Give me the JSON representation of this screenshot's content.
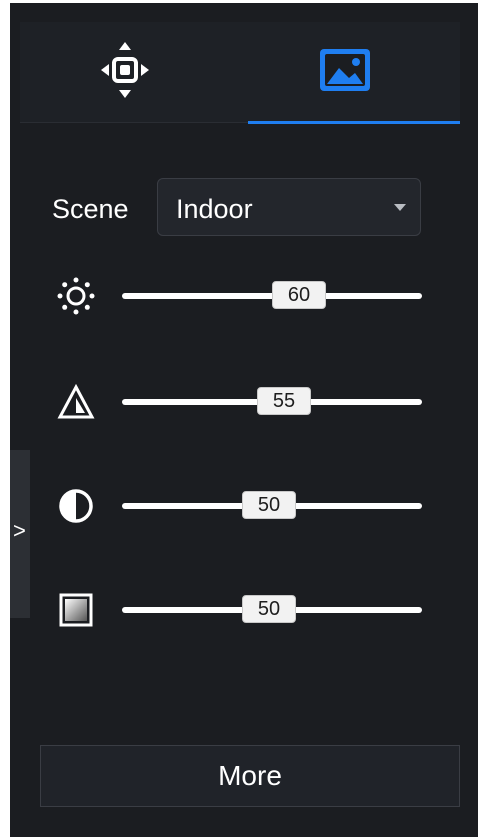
{
  "tabs": [
    {
      "icon": "ptz-move-icon",
      "active": false
    },
    {
      "icon": "image-settings-icon",
      "active": true
    }
  ],
  "scene": {
    "label": "Scene",
    "value": "Indoor"
  },
  "sliders": [
    {
      "name": "brightness",
      "icon": "brightness-icon",
      "value": "60",
      "fraction": 0.6
    },
    {
      "name": "sharpness",
      "icon": "sharpness-icon",
      "value": "55",
      "fraction": 0.55
    },
    {
      "name": "contrast",
      "icon": "contrast-icon",
      "value": "50",
      "fraction": 0.5
    },
    {
      "name": "saturation",
      "icon": "saturation-icon",
      "value": "50",
      "fraction": 0.5
    }
  ],
  "collapse_label": ">",
  "more_label": "More",
  "colors": {
    "background": "#1b1d21",
    "accent": "#1f7ef0"
  }
}
